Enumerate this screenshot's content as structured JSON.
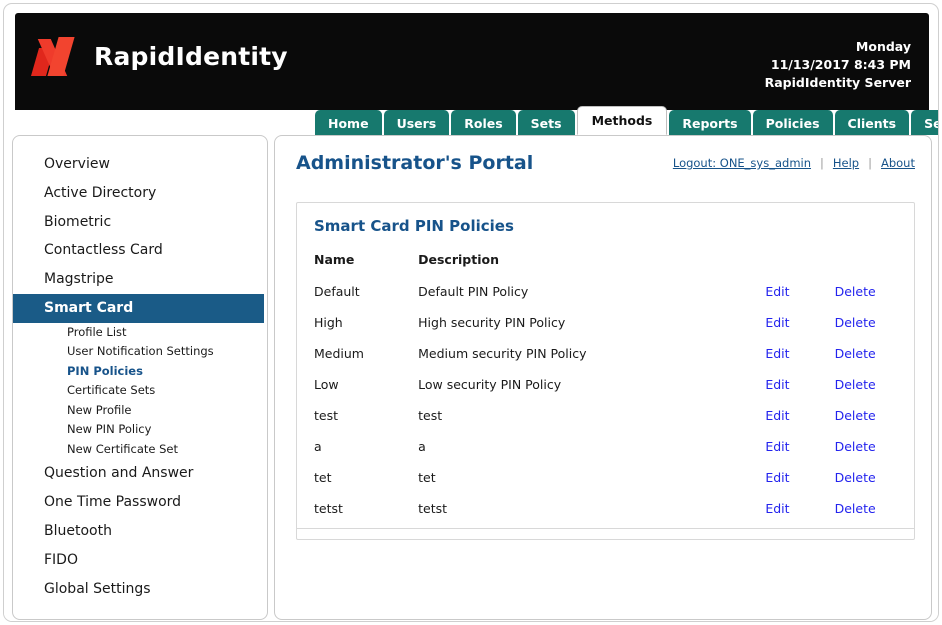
{
  "brand": {
    "name": "RapidIdentity",
    "logo_icon": "rapididentity-logo-icon",
    "logo_color_primary": "#f2442f",
    "logo_color_secondary": "#e0271c"
  },
  "server_info": {
    "day": "Monday",
    "datetime": "11/13/2017 8:43 PM",
    "server": "RapidIdentity Server"
  },
  "tabs": [
    {
      "label": "Home",
      "active": false
    },
    {
      "label": "Users",
      "active": false
    },
    {
      "label": "Roles",
      "active": false
    },
    {
      "label": "Sets",
      "active": false
    },
    {
      "label": "Methods",
      "active": true
    },
    {
      "label": "Reports",
      "active": false
    },
    {
      "label": "Policies",
      "active": false
    },
    {
      "label": "Clients",
      "active": false
    },
    {
      "label": "Settings",
      "active": false
    }
  ],
  "sidebar": {
    "items": [
      {
        "label": "Overview",
        "selected": false
      },
      {
        "label": "Active Directory",
        "selected": false
      },
      {
        "label": "Biometric",
        "selected": false
      },
      {
        "label": "Contactless Card",
        "selected": false
      },
      {
        "label": "Magstripe",
        "selected": false
      },
      {
        "label": "Smart Card",
        "selected": true
      },
      {
        "label": "Question and Answer",
        "selected": false
      },
      {
        "label": "One Time Password",
        "selected": false
      },
      {
        "label": "Bluetooth",
        "selected": false
      },
      {
        "label": "FIDO",
        "selected": false
      },
      {
        "label": "Global Settings",
        "selected": false
      }
    ],
    "subitems": [
      {
        "label": "Profile List",
        "current": false
      },
      {
        "label": "User Notification Settings",
        "current": false
      },
      {
        "label": "PIN Policies",
        "current": true
      },
      {
        "label": "Certificate Sets",
        "current": false
      },
      {
        "label": "New Profile",
        "current": false
      },
      {
        "label": "New PIN Policy",
        "current": false
      },
      {
        "label": "New Certificate Set",
        "current": false
      }
    ]
  },
  "content": {
    "portal_title": "Administrator's Portal",
    "toplinks": {
      "logout": "Logout: ONE_sys_admin",
      "help": "Help",
      "about": "About",
      "separator": "|"
    },
    "card": {
      "title": "Smart Card PIN Policies",
      "columns": {
        "name": "Name",
        "description": "Description",
        "edit": "",
        "delete": ""
      },
      "actions": {
        "edit": "Edit",
        "delete": "Delete"
      },
      "rows": [
        {
          "name": "Default",
          "description": "Default PIN Policy"
        },
        {
          "name": "High",
          "description": "High security PIN Policy"
        },
        {
          "name": "Medium",
          "description": "Medium security PIN Policy"
        },
        {
          "name": "Low",
          "description": "Low security PIN Policy"
        },
        {
          "name": "test",
          "description": "test"
        },
        {
          "name": "a",
          "description": "a"
        },
        {
          "name": "tet",
          "description": "tet"
        },
        {
          "name": "tetst",
          "description": "tetst"
        }
      ]
    }
  },
  "colors": {
    "tab_teal": "#17796e",
    "nav_selected_blue": "#1a5b87",
    "heading_blue": "#17538a",
    "link_blue": "#2323ee",
    "masthead_black": "#0a0a0a"
  }
}
